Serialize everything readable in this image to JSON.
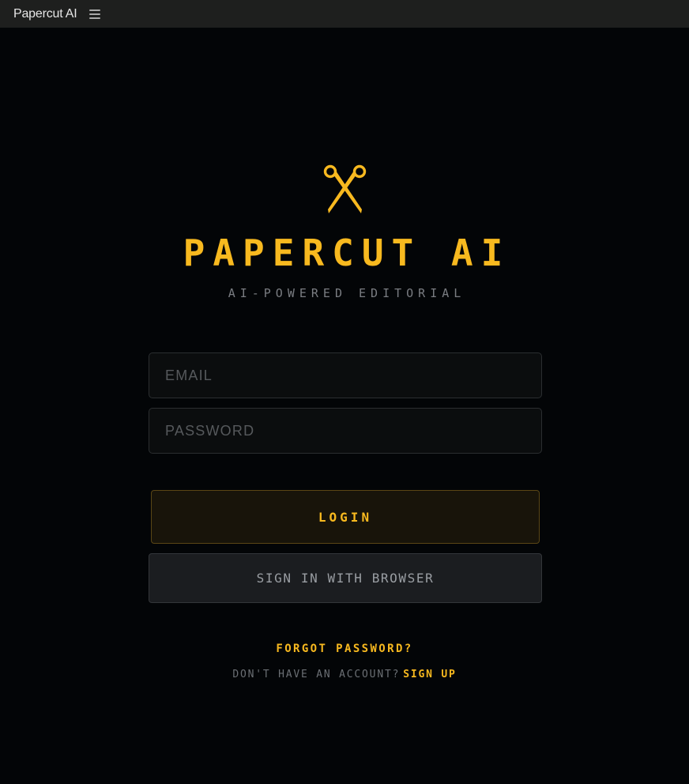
{
  "window": {
    "title": "Papercut AI",
    "menu_icon": "hamburger-menu-icon"
  },
  "brand": {
    "logo_icon": "scissors-icon",
    "title": "PAPERCUT AI",
    "subtitle": "AI-POWERED EDITORIAL",
    "accent_color": "#f8b91f"
  },
  "form": {
    "email_placeholder": "EMAIL",
    "email_value": "",
    "password_placeholder": "PASSWORD",
    "password_value": "",
    "login_label": "LOGIN",
    "browser_label": "SIGN IN WITH BROWSER",
    "forgot_label": "FORGOT PASSWORD?",
    "no_account_text": "DON'T HAVE AN ACCOUNT?",
    "signup_label": "SIGN UP"
  }
}
